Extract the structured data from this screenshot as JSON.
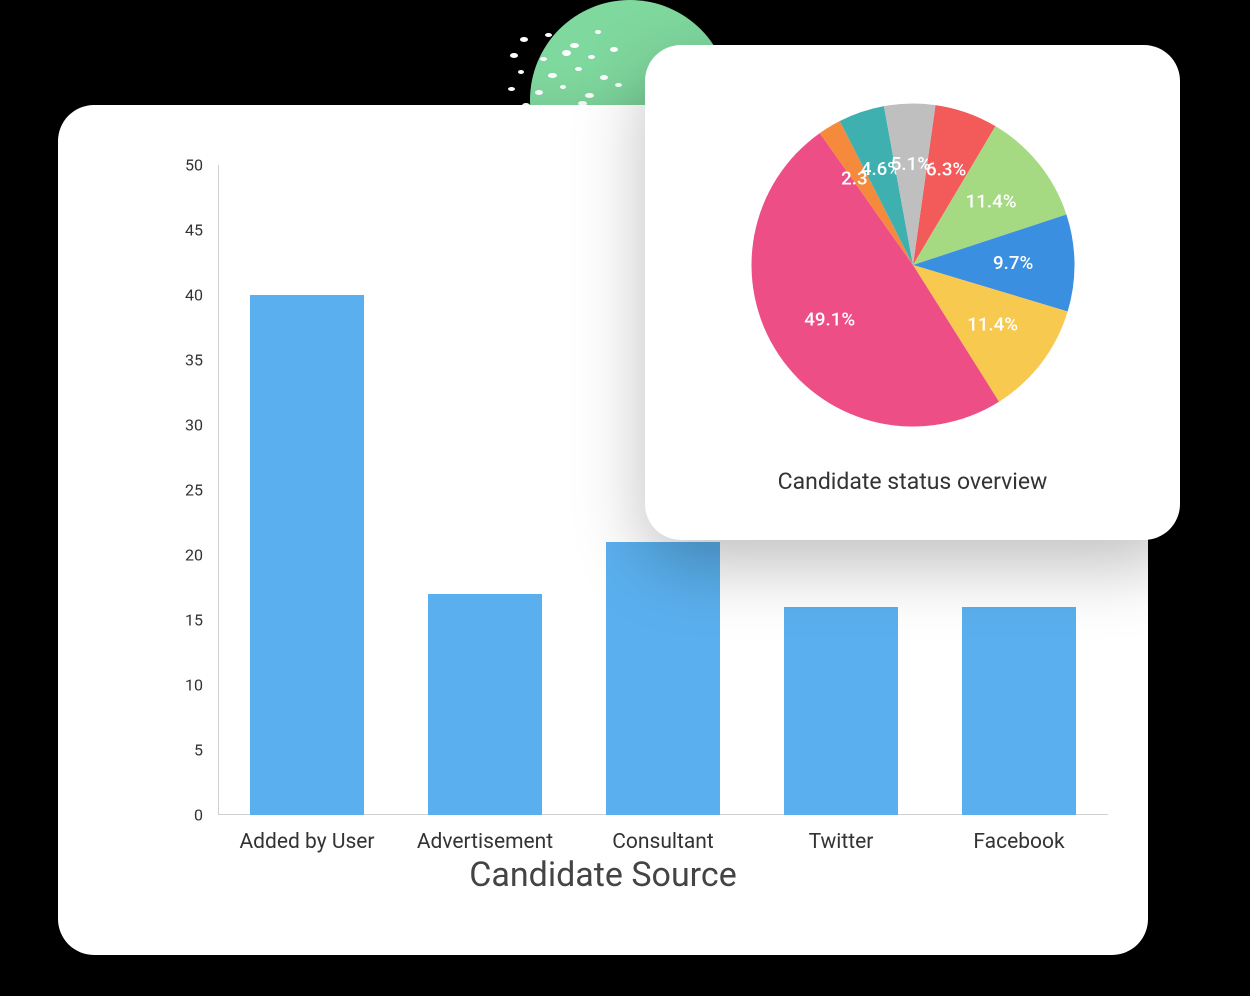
{
  "chart_data": [
    {
      "type": "bar",
      "title": "Candidate Source",
      "categories": [
        "Added by User",
        "Advertisement",
        "Consultant",
        "Twitter",
        "Facebook"
      ],
      "values": [
        40,
        17,
        21,
        16,
        16
      ],
      "ylim": [
        0,
        50
      ],
      "yticks": [
        0,
        5,
        10,
        15,
        20,
        25,
        30,
        35,
        40,
        45,
        50
      ],
      "bar_color": "#5ab0ee"
    },
    {
      "type": "pie",
      "title": "Candidate status overview",
      "slices": [
        {
          "label": "6.3%",
          "value": 6.3,
          "color": "#f35b5b"
        },
        {
          "label": "11.4%",
          "value": 11.4,
          "color": "#a5d982"
        },
        {
          "label": "9.7%",
          "value": 9.7,
          "color": "#3a8fe0"
        },
        {
          "label": "11.4%",
          "value": 11.4,
          "color": "#f7c94f"
        },
        {
          "label": "49.1%",
          "value": 49.1,
          "color": "#ee4e86"
        },
        {
          "label": "2.3%",
          "value": 2.3,
          "color": "#f58a3c"
        },
        {
          "label": "4.6%",
          "value": 4.6,
          "color": "#3fb0b0"
        },
        {
          "label": "5.1%",
          "value": 5.1,
          "color": "#bfbfbf"
        }
      ]
    }
  ]
}
